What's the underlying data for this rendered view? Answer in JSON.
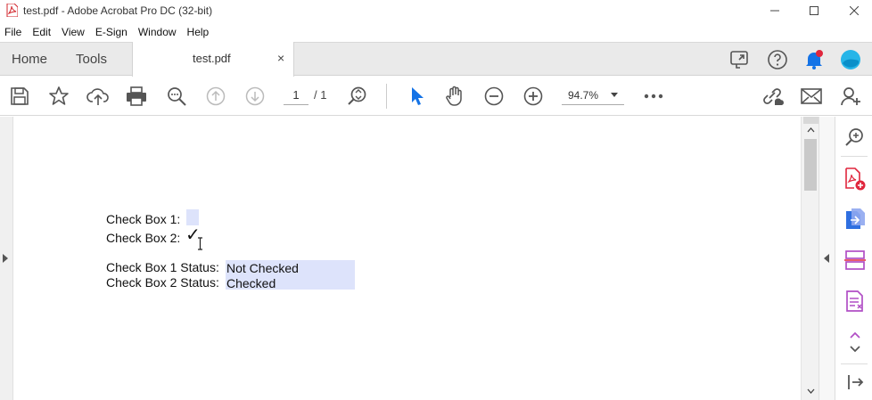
{
  "window": {
    "title": "test.pdf - Adobe Acrobat Pro DC (32-bit)"
  },
  "menu": [
    "File",
    "Edit",
    "View",
    "E-Sign",
    "Window",
    "Help"
  ],
  "tabs": {
    "home": "Home",
    "tools": "Tools",
    "document": "test.pdf",
    "close_glyph": "×"
  },
  "toolbar": {
    "page_current": "1",
    "page_total": "/ 1",
    "zoom": "94.7%"
  },
  "document": {
    "checkbox1_label": "Check Box 1:",
    "checkbox2_label": "Check Box 2:",
    "checkbox2_mark": "✓",
    "status1_label": "Check Box 1 Status:",
    "status2_label": "Check Box 2 Status:",
    "status1_value": "Not Checked",
    "status2_value": "Checked"
  },
  "colors": {
    "accent_blue": "#1473e6",
    "field_highlight": "#dde3fb",
    "pdf_red": "#e0263d",
    "purple": "#b14fc5"
  },
  "icons": {
    "toolbar": [
      "save-icon",
      "bookmark-star-icon",
      "upload-cloud-icon",
      "print-icon",
      "find-icon",
      "previous-page-icon",
      "next-page-icon",
      "page-zoom-icon",
      "select-arrow-icon",
      "hand-icon",
      "zoom-out-icon",
      "zoom-in-icon",
      "more-icon",
      "share-link-icon",
      "email-icon",
      "add-user-icon"
    ],
    "right_pane": [
      "zoom-search-icon",
      "create-pdf-icon",
      "export-pdf-icon",
      "organize-pages-icon",
      "edit-form-icon",
      "expand-collapse-icon",
      "exit-panel-icon"
    ]
  }
}
